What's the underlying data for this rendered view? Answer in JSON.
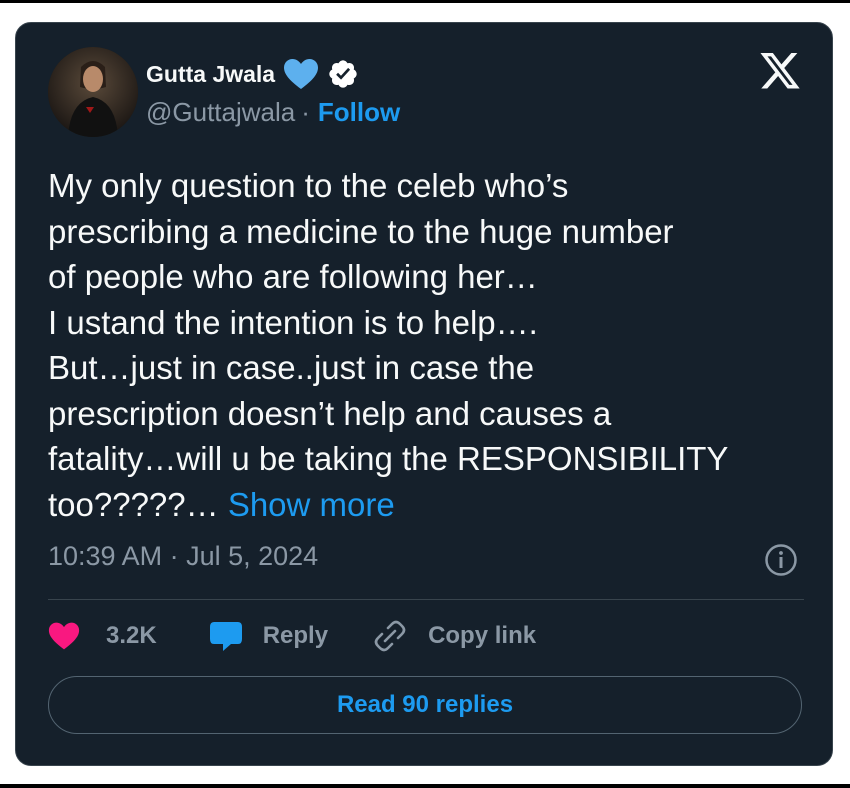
{
  "tweet": {
    "author": {
      "name": "Gutta Jwala",
      "handle": "@Guttajwala",
      "separator": "·",
      "follow_label": "Follow"
    },
    "body_lines": [
      "My only question to the celeb who’s",
      "prescribing a medicine to the huge number",
      "of people who are following her…",
      "I ustand the intention is to help….",
      "But…just in case..just in case the",
      "prescription doesn’t help and causes a",
      "fatality…will u be taking the RESPONSIBILITY",
      "too?????…"
    ],
    "show_more_label": "Show more",
    "timestamp": "10:39 AM · Jul 5, 2024",
    "actions": {
      "like_count": "3.2K",
      "reply_label": "Reply",
      "copy_link_label": "Copy link"
    },
    "read_replies_label": "Read 90 replies"
  },
  "icons": {
    "x_logo": "x-logo-icon",
    "blue_heart": "blue-heart-icon",
    "verified": "verified-badge-icon",
    "info": "info-icon",
    "like": "heart-icon",
    "reply": "reply-bubble-icon",
    "copy_link": "link-icon"
  },
  "colors": {
    "card_bg": "#15202b",
    "text": "#f7f9f9",
    "muted": "#8b98a5",
    "accent": "#1d9bf0",
    "like": "#f91880",
    "blue_heart": "#5db0ee",
    "border": "#38444d"
  }
}
